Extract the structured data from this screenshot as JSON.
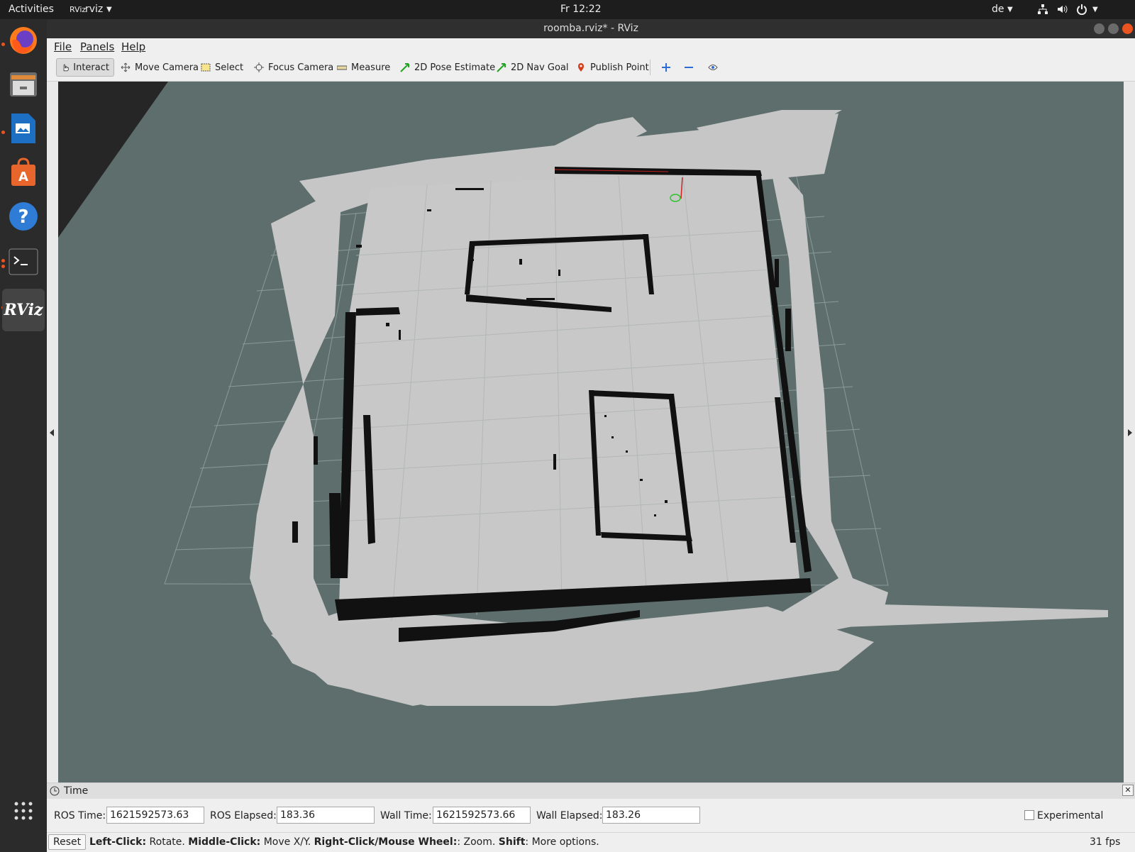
{
  "topbar": {
    "activities": "Activities",
    "app_name": "rviz",
    "clock": "Fr 12:22",
    "keyboard_layout": "de"
  },
  "window": {
    "title": "roomba.rviz* - RViz"
  },
  "menu": [
    "File",
    "Panels",
    "Help"
  ],
  "toolbar": {
    "tools": [
      "Interact",
      "Move Camera",
      "Select",
      "Focus Camera",
      "Measure",
      "2D Pose Estimate",
      "2D Nav Goal",
      "Publish Point"
    ],
    "active_tool": "Interact"
  },
  "dock": {
    "icons": [
      "firefox-icon",
      "files-icon",
      "writer-icon",
      "software-icon",
      "help-icon",
      "terminal-icon",
      "rviz-icon",
      "show-apps-icon"
    ],
    "rviz_label": "RViz"
  },
  "viewport": {
    "background": "#5d6e6d",
    "map_free": "#c8c8c8",
    "map_obstacle": "#111111"
  },
  "time_panel": {
    "title": "Time",
    "ros_time_label": "ROS Time:",
    "ros_time": "1621592573.63",
    "ros_elapsed_label": "ROS Elapsed:",
    "ros_elapsed": "183.36",
    "wall_time_label": "Wall Time:",
    "wall_time": "1621592573.66",
    "wall_elapsed_label": "Wall Elapsed:",
    "wall_elapsed": "183.26",
    "experimental_label": "Experimental",
    "experimental_checked": false
  },
  "status": {
    "reset": "Reset",
    "left_click_key": "Left-Click:",
    "left_click_desc": "Rotate.",
    "middle_click_key": "Middle-Click:",
    "middle_click_desc": "Move X/Y.",
    "right_click_key": "Right-Click/Mouse Wheel:",
    "right_click_desc": ": Zoom.",
    "shift_key": "Shift",
    "shift_desc": ": More options.",
    "fps": "31 fps"
  }
}
